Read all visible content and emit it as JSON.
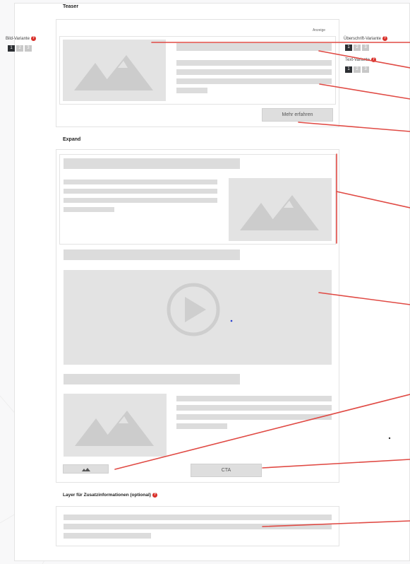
{
  "sections": {
    "teaser": "Teaser",
    "expand": "Expand",
    "layer": "Layer für Zusatzinformationen (optional)"
  },
  "labels": {
    "bild_variante": "Bild-Variante",
    "ueberschrift_variante": "Überschrift-Variante",
    "text_variante": "Text-Variante"
  },
  "variants": [
    "1",
    "2",
    "3"
  ],
  "teaser": {
    "anzeige": "Anzeige",
    "button": "Mehr erfahren"
  },
  "expand": {
    "cta": "CTA"
  },
  "colors": {
    "accent_red": "#d9302a",
    "placeholder": "#dcdcdc",
    "active_variant": "#2c2f33"
  }
}
